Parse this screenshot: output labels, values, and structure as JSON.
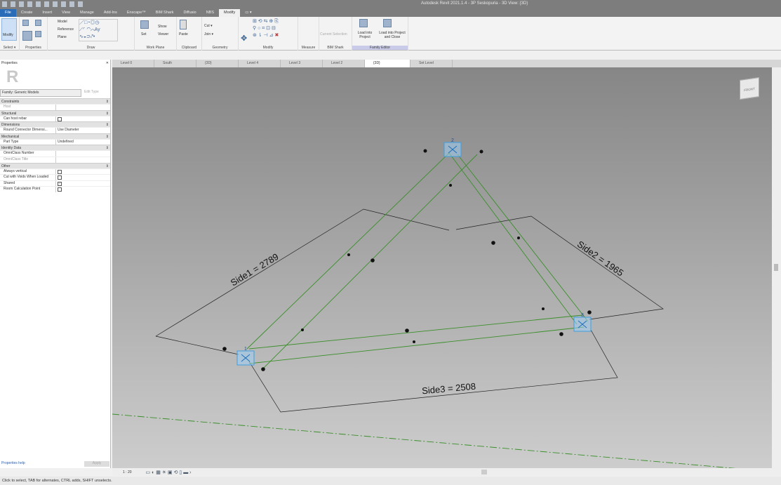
{
  "title_bar": {
    "title": "Autodesk Revit 2021.1.4 - 3P Seskopuria - 3D View: {3D}"
  },
  "ribbon_tabs": [
    "File",
    "Create",
    "Insert",
    "View",
    "Manage",
    "Add-Ins",
    "Enscape™",
    "BIM Shark",
    "Diffusio",
    "NBS",
    "Modify",
    "▭ ▾"
  ],
  "active_tab": "Modify",
  "ribbon": {
    "select": {
      "button": "Modify",
      "label": "Select ▾"
    },
    "properties": {
      "label": "Properties"
    },
    "draw": {
      "label": "Draw",
      "items": [
        "Model",
        "Reference",
        "Plane"
      ]
    },
    "work_plane": {
      "label": "Work Plane",
      "items": [
        "Set",
        "Show",
        "Viewer"
      ]
    },
    "clipboard": {
      "label": "Clipboard",
      "items": [
        "Paste"
      ]
    },
    "geometry": {
      "label": "Geometry",
      "items": [
        "Cut ▾",
        "Join ▾"
      ]
    },
    "modify": {
      "label": "Modify"
    },
    "measure": {
      "label": "Measure"
    },
    "bim_shark": {
      "label": "BIM Shark",
      "items": [
        "Current Selection"
      ]
    },
    "family_editor": {
      "label": "Family Editor",
      "items": [
        "Load into Project",
        "Load into Project and Close"
      ]
    }
  },
  "doc_tabs": [
    "Level 0",
    "South",
    "{3D}",
    "Level 4",
    "Level 3",
    "Level 2",
    "{3D}",
    "Set Level"
  ],
  "active_doc_tab": "{3D}",
  "properties": {
    "title": "Properties",
    "family": "Family: Generic Models",
    "edit_type": "Edit Type",
    "groups": [
      {
        "name": "Constraints",
        "rows": [
          {
            "key": "Host",
            "value": "",
            "dim": true
          }
        ]
      },
      {
        "name": "Structural",
        "rows": [
          {
            "key": "Can host rebar",
            "checkbox": false
          }
        ]
      },
      {
        "name": "Dimensions",
        "rows": [
          {
            "key": "Round Connector Dimensi...",
            "value": "Use Diameter"
          }
        ]
      },
      {
        "name": "Mechanical",
        "rows": [
          {
            "key": "Part Type",
            "value": "Undefined"
          }
        ]
      },
      {
        "name": "Identity Data",
        "rows": [
          {
            "key": "OmniClass Number",
            "value": ""
          },
          {
            "key": "OmniClass Title",
            "value": "",
            "dim": true
          }
        ]
      },
      {
        "name": "Other",
        "rows": [
          {
            "key": "Always vertical",
            "checkbox": false
          },
          {
            "key": "Cut with Voids When Loaded",
            "checkbox": false
          },
          {
            "key": "Shared",
            "checkbox": true
          },
          {
            "key": "Room Calculation Point",
            "checkbox": false
          }
        ]
      }
    ],
    "help": "Properties help",
    "apply": "Apply"
  },
  "viewcube": "FRONT",
  "model": {
    "dimensions": [
      {
        "label": "Side1 = 2789"
      },
      {
        "label": "Side2 = 1965"
      },
      {
        "label": "Side3 = 2508"
      }
    ],
    "points": [
      "1",
      "2",
      "3"
    ],
    "colors": {
      "ref_line": "#3a8f2a",
      "dimension": "#222222",
      "point": "#3f9ee0"
    }
  },
  "view_control_bar": {
    "scale": "1 : 20"
  },
  "status_bar": "Click to select, TAB for alternates, CTRL adds, SHIFT unselects."
}
